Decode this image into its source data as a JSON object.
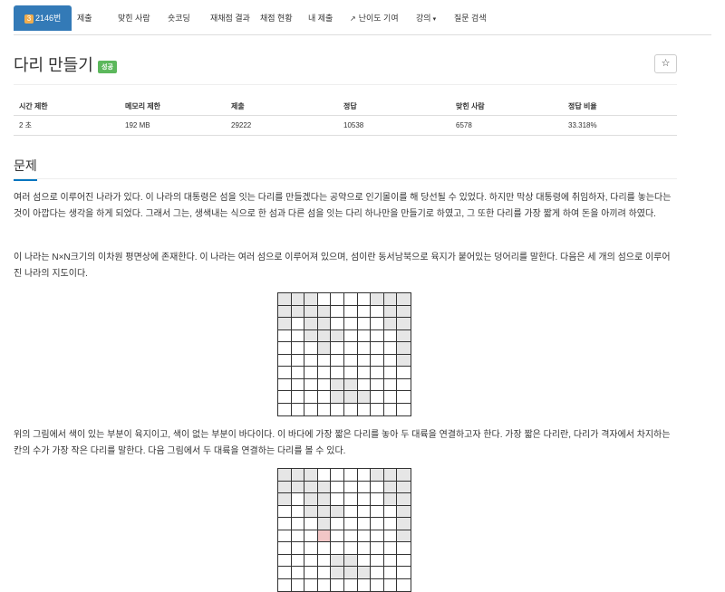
{
  "tabs": [
    {
      "badge": "3",
      "label": "2146번",
      "active": true
    },
    {
      "label": "제출"
    },
    {
      "label": "맞힌 사람"
    },
    {
      "label": "숏코딩"
    },
    {
      "label": "재채점 결과"
    },
    {
      "label": "채점 현황"
    },
    {
      "label": "내 제출"
    },
    {
      "icon": "external-link-icon",
      "label": "난이도 기여"
    },
    {
      "label": "강의",
      "dropdown": true
    },
    {
      "label": "질문 검색"
    }
  ],
  "problem": {
    "title": "다리 만들기",
    "status_label": "성공",
    "star_icon": "☆"
  },
  "info_table": {
    "headers": [
      "시간 제한",
      "메모리 제한",
      "제출",
      "정답",
      "맞힌 사람",
      "정답 비율"
    ],
    "values": [
      "2 초",
      "192 MB",
      "29222",
      "10538",
      "6578",
      "33.318%"
    ]
  },
  "section": {
    "title": "문제",
    "paragraphs": [
      "여러 섬으로 이루어진 나라가 있다. 이 나라의 대통령은 섬을 잇는 다리를 만들겠다는 공약으로 인기몰이를 해 당선될 수 있었다. 하지만 막상 대통령에 취임하자, 다리를 놓는다는 것이 아깝다는 생각을 하게 되었다. 그래서 그는, 생색내는 식으로 한 섬과 다른 섬을 잇는 다리 하나만을 만들기로 하였고, 그 또한 다리를 가장 짧게 하여 돈을 아끼려 하였다.",
      "이 나라는 N×N크기의 이차원 평면상에 존재한다. 이 나라는 여러 섬으로 이루어져 있으며, 섬이란 동서남북으로 육지가 붙어있는 덩어리를 말한다. 다음은 세 개의 섬으로 이루어진 나라의 지도이다.",
      "위의 그림에서 색이 있는 부분이 육지이고, 색이 없는 부분이 바다이다. 이 바다에 가장 짧은 다리를 놓아 두 대륙을 연결하고자 한다. 가장 짧은 다리란, 다리가 격자에서 차지하는 칸의 수가 가장 작은 다리를 말한다. 다음 그림에서 두 대륙을 연결하는 다리를 볼 수 있다."
    ]
  },
  "colors": {
    "land": "#e6e6e6",
    "bridge": "#f2c6c6",
    "accent": "#337ab7",
    "success": "#5cb85c"
  },
  "map1": {
    "size": 10,
    "land": [
      [
        1,
        1,
        1,
        0,
        0,
        0,
        0,
        1,
        1,
        1
      ],
      [
        1,
        1,
        1,
        1,
        0,
        0,
        0,
        0,
        1,
        1
      ],
      [
        1,
        0,
        1,
        1,
        0,
        0,
        0,
        0,
        1,
        1
      ],
      [
        0,
        0,
        1,
        1,
        1,
        0,
        0,
        0,
        0,
        1
      ],
      [
        0,
        0,
        0,
        1,
        0,
        0,
        0,
        0,
        0,
        1
      ],
      [
        0,
        0,
        0,
        0,
        0,
        0,
        0,
        0,
        0,
        1
      ],
      [
        0,
        0,
        0,
        0,
        0,
        0,
        0,
        0,
        0,
        0
      ],
      [
        0,
        0,
        0,
        0,
        1,
        1,
        0,
        0,
        0,
        0
      ],
      [
        0,
        0,
        0,
        0,
        1,
        1,
        1,
        0,
        0,
        0
      ],
      [
        0,
        0,
        0,
        0,
        0,
        0,
        0,
        0,
        0,
        0
      ]
    ]
  },
  "map2": {
    "size": 10,
    "land": [
      [
        1,
        1,
        1,
        0,
        0,
        0,
        0,
        1,
        1,
        1
      ],
      [
        1,
        1,
        1,
        1,
        0,
        0,
        0,
        0,
        1,
        1
      ],
      [
        1,
        0,
        1,
        1,
        0,
        0,
        0,
        0,
        1,
        1
      ],
      [
        0,
        0,
        1,
        1,
        1,
        0,
        0,
        0,
        0,
        1
      ],
      [
        0,
        0,
        0,
        1,
        0,
        0,
        0,
        0,
        0,
        1
      ],
      [
        0,
        0,
        0,
        0,
        0,
        0,
        0,
        0,
        0,
        1
      ],
      [
        0,
        0,
        0,
        0,
        0,
        0,
        0,
        0,
        0,
        0
      ],
      [
        0,
        0,
        0,
        0,
        1,
        1,
        0,
        0,
        0,
        0
      ],
      [
        0,
        0,
        0,
        0,
        1,
        1,
        1,
        0,
        0,
        0
      ],
      [
        0,
        0,
        0,
        0,
        0,
        0,
        0,
        0,
        0,
        0
      ]
    ],
    "bridge": [
      [
        5,
        3
      ]
    ]
  }
}
